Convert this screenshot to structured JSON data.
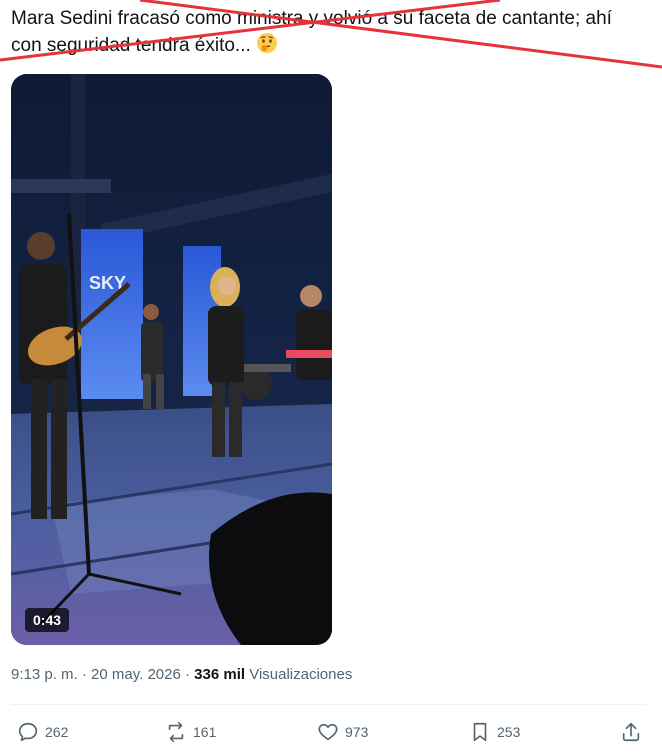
{
  "tweet": {
    "text_line1": "Mara Sedini fracasó como ministra y volvió a su faceta de cantante; ahí",
    "text_line2": "con seguridad tendrá éxito...",
    "emoji": "thinking-face-emoji"
  },
  "overlay": {
    "strike_color": "#e8323a"
  },
  "video": {
    "duration": "0:43",
    "screen_text": "SKY"
  },
  "meta": {
    "time": "9:13 p. m.",
    "separator1": " · ",
    "date": "20 may. 2026",
    "separator2": " · ",
    "views_count": "336 mil",
    "views_label": "Visualizaciones"
  },
  "actions": {
    "replies": "262",
    "reposts": "161",
    "likes": "973",
    "bookmarks": "253"
  },
  "colors": {
    "text": "#0f1419",
    "secondary": "#536471",
    "divider": "#eff3f4",
    "strike": "#e8323a"
  },
  "icons": [
    "reply-icon",
    "repost-icon",
    "like-icon",
    "bookmark-icon",
    "share-icon"
  ]
}
